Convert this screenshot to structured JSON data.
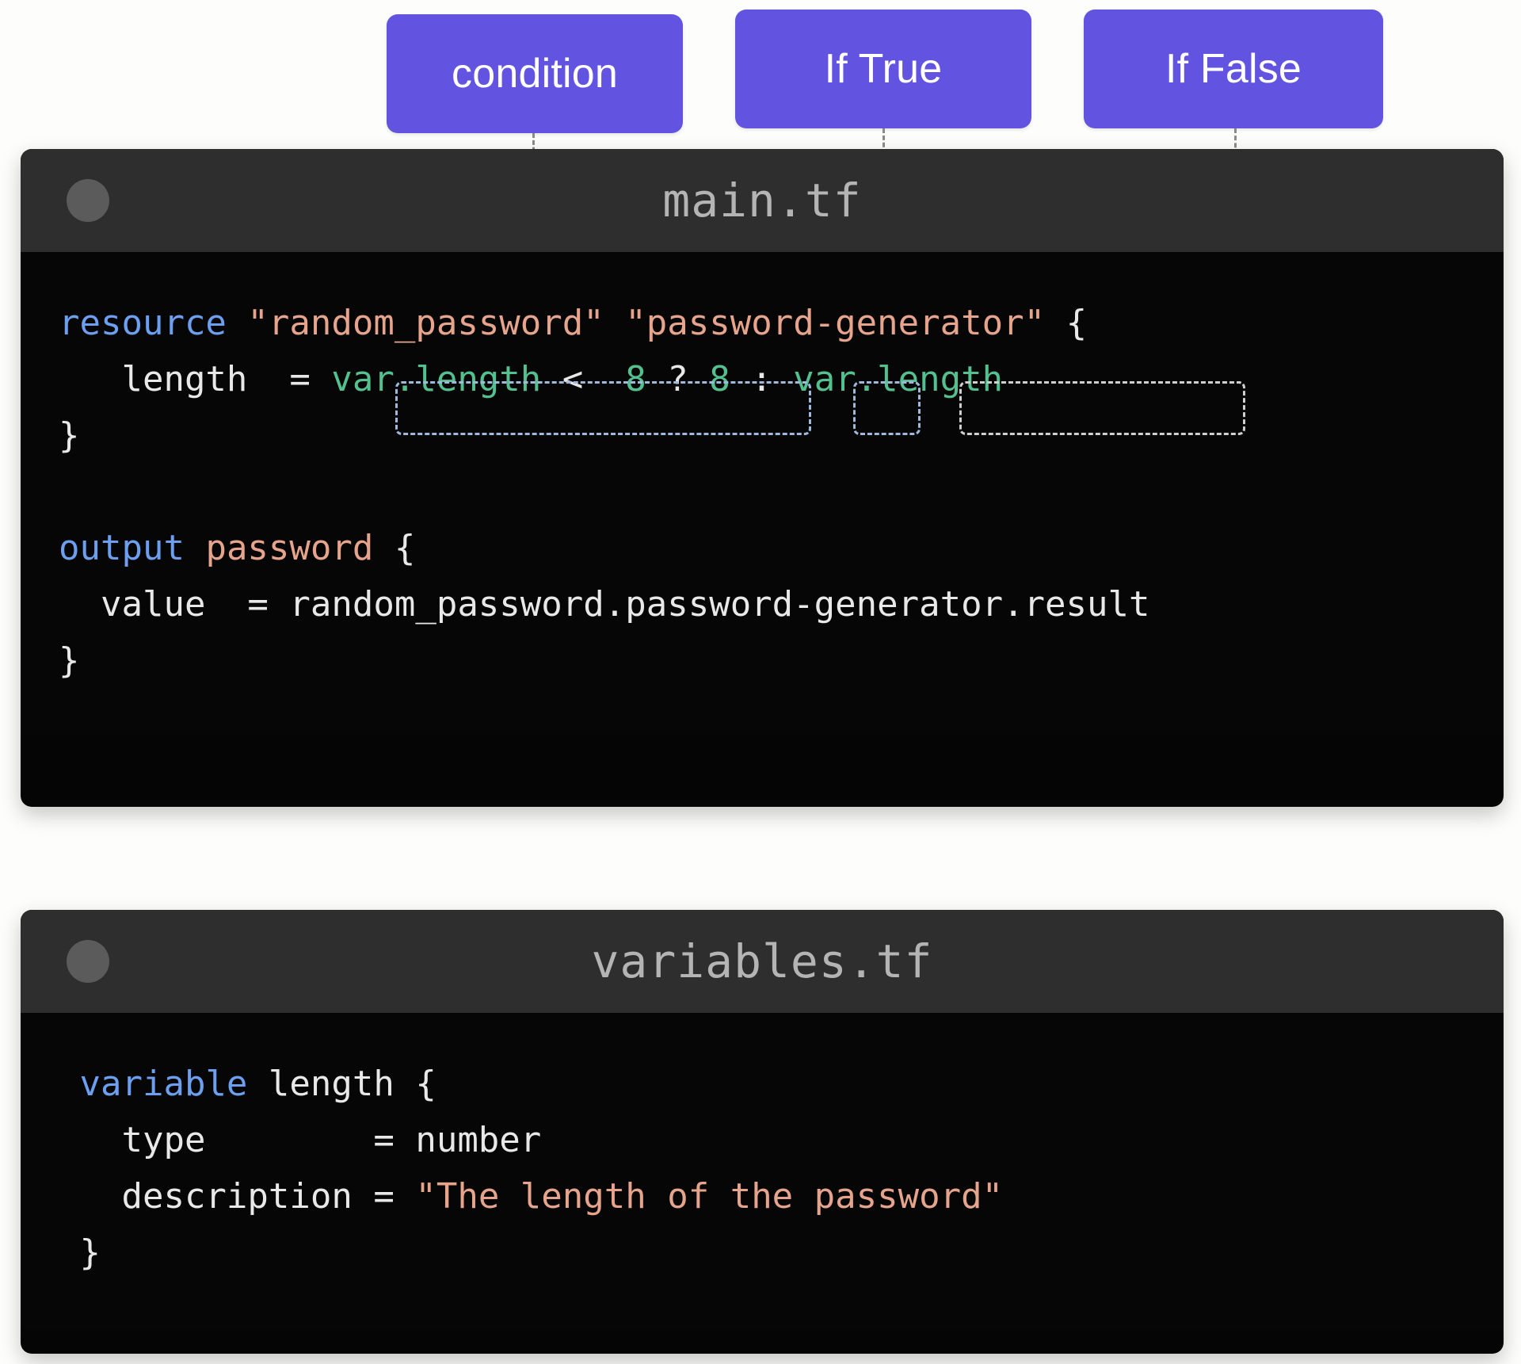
{
  "annotations": {
    "badges": [
      {
        "id": "condition",
        "label": "condition"
      },
      {
        "id": "if_true",
        "label": "If True"
      },
      {
        "id": "if_false",
        "label": "If False"
      }
    ],
    "accent_color": "#6254e0",
    "highlight": {
      "condition_expression": "var.length <  8",
      "if_true_expression": "8",
      "if_false_expression": "var.length"
    }
  },
  "windows": [
    {
      "id": "main-tf",
      "filename": "main.tf",
      "dot_color": "#5b5b5b",
      "titlebar_color": "#2e2e2e",
      "background_color": "#060606",
      "code_lines": [
        {
          "tokens": [
            {
              "text": "resource",
              "cls": "kw"
            },
            {
              "text": " ",
              "cls": "pl"
            },
            {
              "text": "\"random_password\"",
              "cls": "str"
            },
            {
              "text": " ",
              "cls": "pl"
            },
            {
              "text": "\"password-generator\"",
              "cls": "str"
            },
            {
              "text": " {",
              "cls": "pl"
            }
          ]
        },
        {
          "tokens": [
            {
              "text": "   length  = ",
              "cls": "pl"
            },
            {
              "text": "var.length",
              "cls": "var"
            },
            {
              "text": " <  ",
              "cls": "pl"
            },
            {
              "text": "8",
              "cls": "num"
            },
            {
              "text": " ? ",
              "cls": "pl"
            },
            {
              "text": "8",
              "cls": "num"
            },
            {
              "text": " : ",
              "cls": "pl"
            },
            {
              "text": "var.length",
              "cls": "var"
            }
          ]
        },
        {
          "tokens": [
            {
              "text": "}",
              "cls": "pl"
            }
          ]
        },
        {
          "tokens": [
            {
              "text": "",
              "cls": "pl"
            }
          ]
        },
        {
          "tokens": [
            {
              "text": "output",
              "cls": "kw"
            },
            {
              "text": " ",
              "cls": "pl"
            },
            {
              "text": "password",
              "cls": "str"
            },
            {
              "text": " {",
              "cls": "pl"
            }
          ]
        },
        {
          "tokens": [
            {
              "text": "  value  = random_password.password-generator.result",
              "cls": "pl"
            }
          ]
        },
        {
          "tokens": [
            {
              "text": "}",
              "cls": "pl"
            }
          ]
        }
      ]
    },
    {
      "id": "variables-tf",
      "filename": "variables.tf",
      "dot_color": "#5b5b5b",
      "titlebar_color": "#2e2e2e",
      "background_color": "#060606",
      "code_lines": [
        {
          "tokens": [
            {
              "text": " ",
              "cls": "pl"
            },
            {
              "text": "variable",
              "cls": "kw"
            },
            {
              "text": " length {",
              "cls": "pl"
            }
          ]
        },
        {
          "tokens": [
            {
              "text": "   type        = number",
              "cls": "pl"
            }
          ]
        },
        {
          "tokens": [
            {
              "text": "   description = ",
              "cls": "pl"
            },
            {
              "text": "\"The length of the password\"",
              "cls": "str"
            }
          ]
        },
        {
          "tokens": [
            {
              "text": " }",
              "cls": "pl"
            }
          ]
        }
      ]
    }
  ]
}
